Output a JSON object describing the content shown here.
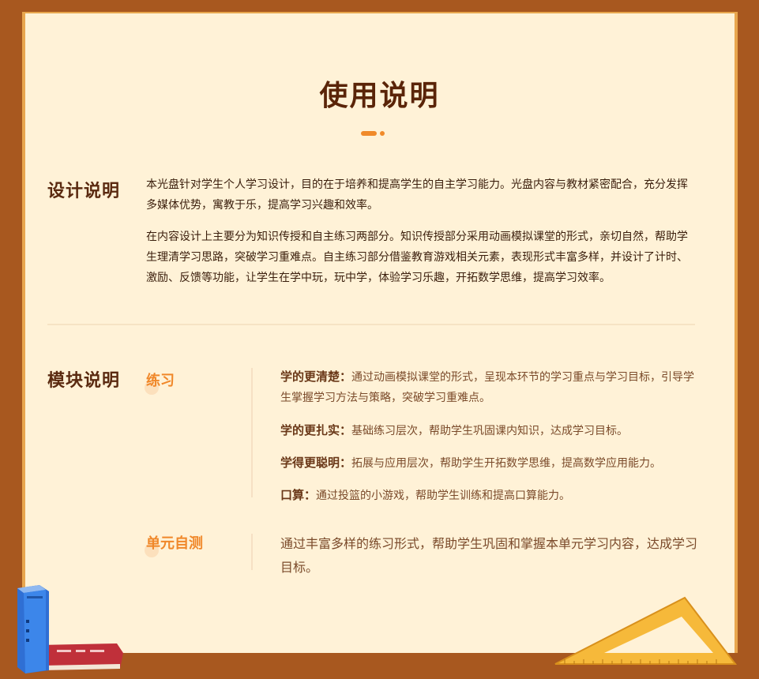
{
  "page": {
    "title": "使用说明"
  },
  "design": {
    "label": "设计说明",
    "paragraphs": [
      "本光盘针对学生个人学习设计，目的在于培养和提高学生的自主学习能力。光盘内容与教材紧密配合，充分发挥多媒体优势，寓教于乐，提高学习兴趣和效率。",
      "在内容设计上主要分为知识传授和自主练习两部分。知识传授部分采用动画模拟课堂的形式，亲切自然，帮助学生理清学习思路，突破学习重难点。自主练习部分借鉴教育游戏相关元素，表现形式丰富多样，并设计了计时、激励、反馈等功能，让学生在学中玩，玩中学，体验学习乐趣，开拓数学思维，提高学习效率。"
    ]
  },
  "modules": {
    "label": "模块说明",
    "practice": {
      "label": "练习",
      "items": [
        {
          "term": "学的更清楚：",
          "desc": "通过动画模拟课堂的形式，呈现本环节的学习重点与学习目标，引导学生掌握学习方法与策略，突破学习重难点。"
        },
        {
          "term": "学的更扎实：",
          "desc": "基础练习层次，帮助学生巩固课内知识，达成学习目标。"
        },
        {
          "term": "学得更聪明：",
          "desc": "拓展与应用层次，帮助学生开拓数学思维，提高数学应用能力。"
        },
        {
          "term": "口算：",
          "desc": "通过投篮的小游戏，帮助学生训练和提高口算能力。"
        }
      ]
    },
    "unit_test": {
      "label": "单元自测",
      "desc": "通过丰富多样的练习形式，帮助学生巩固和掌握本单元学习内容，达成学习目标。"
    }
  },
  "decorations": {
    "books": "books-icon",
    "ruler": "triangle-ruler-icon"
  },
  "colors": {
    "frame": "#a8581f",
    "board": "#fff2d7",
    "accent": "#f08a2a",
    "heading": "#5a2408"
  }
}
